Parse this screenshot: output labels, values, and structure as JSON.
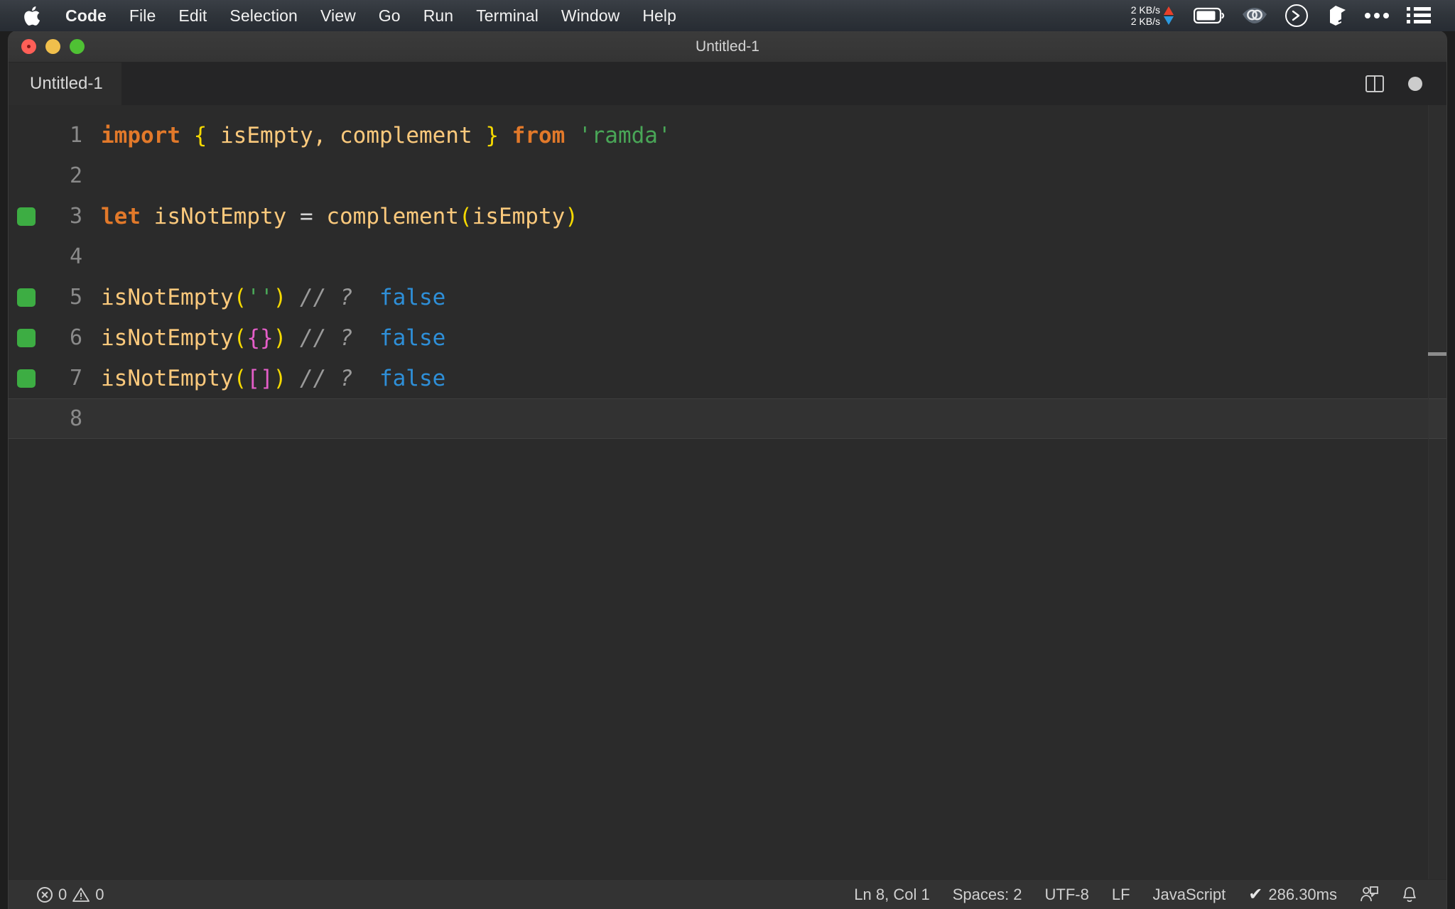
{
  "menubar": {
    "apple_icon": "apple-logo-icon",
    "items": [
      {
        "label": "Code",
        "bold": true
      },
      {
        "label": "File",
        "bold": false
      },
      {
        "label": "Edit",
        "bold": false
      },
      {
        "label": "Selection",
        "bold": false
      },
      {
        "label": "View",
        "bold": false
      },
      {
        "label": "Go",
        "bold": false
      },
      {
        "label": "Run",
        "bold": false
      },
      {
        "label": "Terminal",
        "bold": false
      },
      {
        "label": "Window",
        "bold": false
      },
      {
        "label": "Help",
        "bold": false
      }
    ],
    "network": {
      "upload": "2 KB/s",
      "download": "2 KB/s",
      "upload_color": "#e8402a",
      "download_color": "#2b9ae0"
    },
    "tray_icons": [
      "battery-icon",
      "wifi-eye-icon",
      "terminal-circle-icon",
      "dropbox-icon",
      "ellipsis-icon",
      "list-menu-icon"
    ]
  },
  "window": {
    "title": "Untitled-1",
    "traffic_lights": [
      "close-button",
      "minimize-button",
      "maximize-button"
    ]
  },
  "tabs": [
    {
      "label": "Untitled-1",
      "active": true
    }
  ],
  "tab_actions": {
    "split_editor": "split-editor-icon",
    "unsaved_indicator": "unsaved-dot-icon"
  },
  "editor": {
    "lines": [
      {
        "num": "1",
        "marker": false,
        "current": false,
        "tokens": [
          {
            "text": "import",
            "cls": "t-keyword"
          },
          {
            "text": " ",
            "cls": "t-op"
          },
          {
            "text": "{",
            "cls": "t-brace-y"
          },
          {
            "text": " ",
            "cls": "t-op"
          },
          {
            "text": "isEmpty",
            "cls": "t-ident"
          },
          {
            "text": ",",
            "cls": "t-punc"
          },
          {
            "text": " ",
            "cls": "t-op"
          },
          {
            "text": "complement",
            "cls": "t-ident"
          },
          {
            "text": " ",
            "cls": "t-op"
          },
          {
            "text": "}",
            "cls": "t-brace-y"
          },
          {
            "text": " ",
            "cls": "t-op"
          },
          {
            "text": "from",
            "cls": "t-keyword"
          },
          {
            "text": " ",
            "cls": "t-op"
          },
          {
            "text": "'ramda'",
            "cls": "t-string"
          }
        ]
      },
      {
        "num": "2",
        "marker": false,
        "current": false,
        "tokens": []
      },
      {
        "num": "3",
        "marker": true,
        "current": false,
        "tokens": [
          {
            "text": "let",
            "cls": "t-keyword"
          },
          {
            "text": " ",
            "cls": "t-op"
          },
          {
            "text": "isNotEmpty",
            "cls": "t-ident"
          },
          {
            "text": " ",
            "cls": "t-op"
          },
          {
            "text": "=",
            "cls": "t-op"
          },
          {
            "text": " ",
            "cls": "t-op"
          },
          {
            "text": "complement",
            "cls": "t-ident"
          },
          {
            "text": "(",
            "cls": "t-paren"
          },
          {
            "text": "isEmpty",
            "cls": "t-ident"
          },
          {
            "text": ")",
            "cls": "t-paren"
          }
        ]
      },
      {
        "num": "4",
        "marker": false,
        "current": false,
        "tokens": []
      },
      {
        "num": "5",
        "marker": true,
        "current": false,
        "tokens": [
          {
            "text": "isNotEmpty",
            "cls": "t-ident"
          },
          {
            "text": "(",
            "cls": "t-paren"
          },
          {
            "text": "''",
            "cls": "t-string"
          },
          {
            "text": ")",
            "cls": "t-paren"
          },
          {
            "text": " ",
            "cls": "t-op"
          },
          {
            "text": "// ?",
            "cls": "t-comment"
          },
          {
            "text": "  ",
            "cls": "t-op"
          },
          {
            "text": "false",
            "cls": "t-result"
          }
        ]
      },
      {
        "num": "6",
        "marker": true,
        "current": false,
        "tokens": [
          {
            "text": "isNotEmpty",
            "cls": "t-ident"
          },
          {
            "text": "(",
            "cls": "t-paren"
          },
          {
            "text": "{}",
            "cls": "t-brace-p"
          },
          {
            "text": ")",
            "cls": "t-paren"
          },
          {
            "text": " ",
            "cls": "t-op"
          },
          {
            "text": "// ?",
            "cls": "t-comment"
          },
          {
            "text": "  ",
            "cls": "t-op"
          },
          {
            "text": "false",
            "cls": "t-result"
          }
        ]
      },
      {
        "num": "7",
        "marker": true,
        "current": false,
        "tokens": [
          {
            "text": "isNotEmpty",
            "cls": "t-ident"
          },
          {
            "text": "(",
            "cls": "t-paren"
          },
          {
            "text": "[]",
            "cls": "t-brace-p"
          },
          {
            "text": ")",
            "cls": "t-paren"
          },
          {
            "text": " ",
            "cls": "t-op"
          },
          {
            "text": "// ?",
            "cls": "t-comment"
          },
          {
            "text": "  ",
            "cls": "t-op"
          },
          {
            "text": "false",
            "cls": "t-result"
          }
        ]
      },
      {
        "num": "8",
        "marker": false,
        "current": true,
        "tokens": []
      }
    ],
    "colors": {
      "background": "#2b2b2b",
      "keyword": "#e2792a",
      "identifier": "#fbc97c",
      "string": "#49a657",
      "brace_yellow": "#f5d900",
      "brace_pink": "#e45ec8",
      "comment": "#9a9a9a",
      "result": "#2e8fd8",
      "gutter_marker": "#3dad43",
      "line_number": "#8a8a8a"
    }
  },
  "statusbar": {
    "errors": "0",
    "warnings": "0",
    "error_icon": "error-circle-icon",
    "warning_icon": "warning-triangle-icon",
    "right_items": [
      {
        "label": "Ln 8, Col 1",
        "name": "cursor-position"
      },
      {
        "label": "Spaces: 2",
        "name": "indentation"
      },
      {
        "label": "UTF-8",
        "name": "encoding"
      },
      {
        "label": "LF",
        "name": "line-ending"
      },
      {
        "label": "JavaScript",
        "name": "language-mode"
      }
    ],
    "quokka": {
      "check": "✔",
      "label": "286.30ms"
    },
    "icons": [
      "live-share-icon",
      "bell-icon"
    ]
  }
}
